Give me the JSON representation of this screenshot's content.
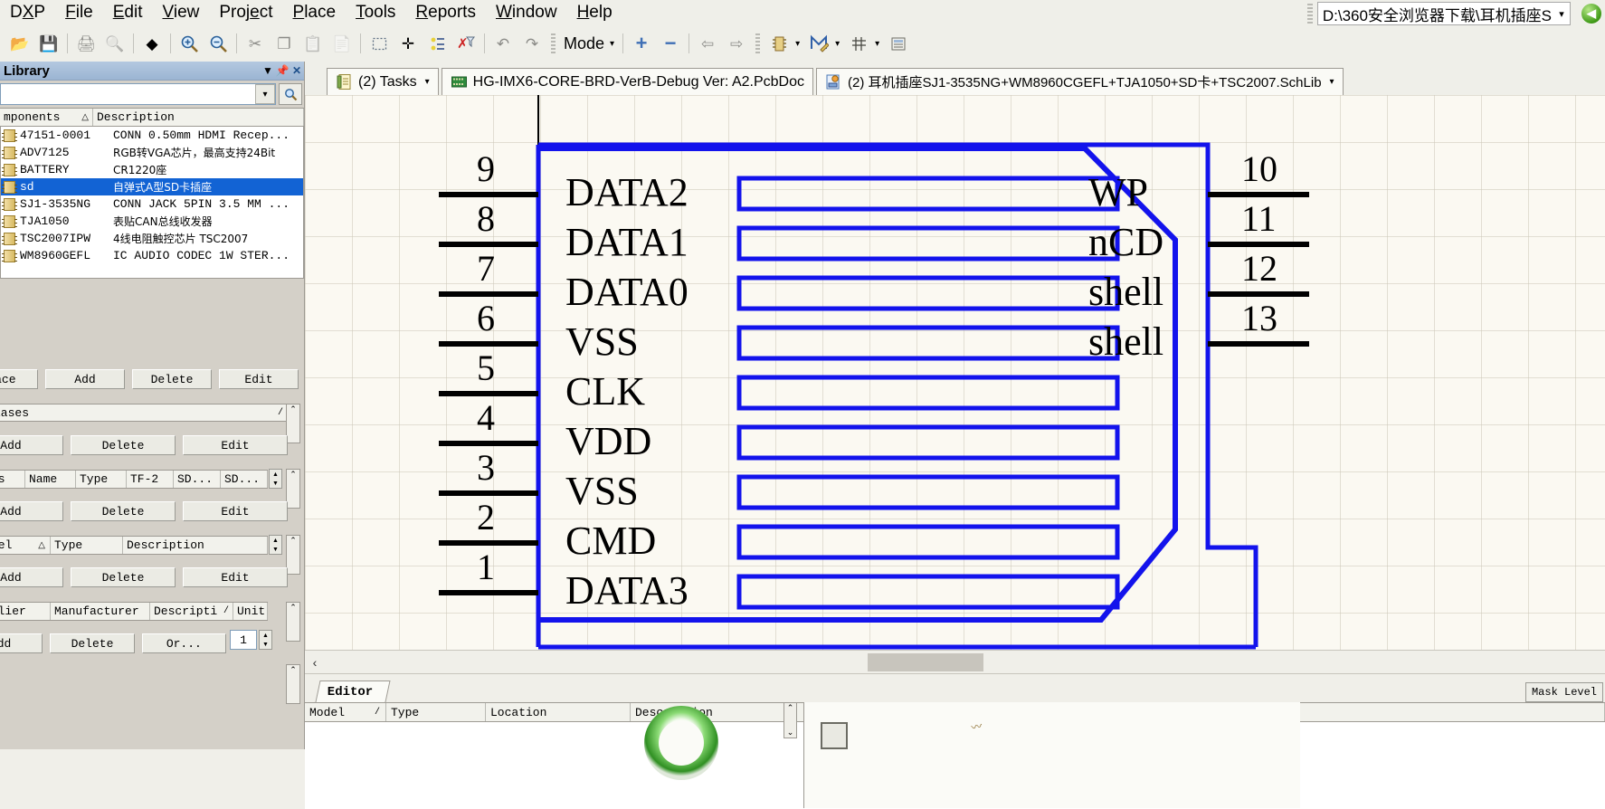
{
  "menu": {
    "items": [
      {
        "pre": "D",
        "accel": "X",
        "post": "P"
      },
      {
        "pre": "",
        "accel": "F",
        "post": "ile"
      },
      {
        "pre": "",
        "accel": "E",
        "post": "dit"
      },
      {
        "pre": "",
        "accel": "V",
        "post": "iew"
      },
      {
        "pre": "Proj",
        "accel": "e",
        "post": "ct"
      },
      {
        "pre": "",
        "accel": "P",
        "post": "lace"
      },
      {
        "pre": "",
        "accel": "T",
        "post": "ools"
      },
      {
        "pre": "",
        "accel": "R",
        "post": "eports"
      },
      {
        "pre": "",
        "accel": "W",
        "post": "indow"
      },
      {
        "pre": "",
        "accel": "H",
        "post": "elp"
      }
    ]
  },
  "path_field": {
    "value": "D:\\360安全浏览器下载\\耳机插座S",
    "caret": "▾"
  },
  "toolbar": {
    "mode_label": "Mode",
    "caret": "▾",
    "icons": [
      "open-folder-icon",
      "save-icon",
      "print-icon",
      "print-preview-icon",
      "board-view-icon",
      "zoom-in-icon",
      "zoom-out-icon",
      "cut-icon",
      "copy-icon",
      "paste-icon",
      "paste-special-icon",
      "select-area-icon",
      "move-icon",
      "smart-paste-icon",
      "clear-filter-icon",
      "undo-icon",
      "redo-icon",
      "add-icon",
      "remove-icon",
      "back-icon",
      "forward-icon",
      "component-icon",
      "draw-icon",
      "grid-icon",
      "browse-icon"
    ]
  },
  "library_panel": {
    "title": "Library",
    "title_icons": [
      "pin-icon",
      "close-icon",
      "chevron-down-icon"
    ],
    "search_value": "",
    "search_caret": "▾",
    "find_icon": "search-icon",
    "components_header": {
      "name_col": "mponents",
      "sort_mark": "△",
      "desc_col": "Description"
    },
    "components": [
      {
        "name": "47151-0001",
        "desc": "CONN 0.50mm HDMI Recep...",
        "cjk": false,
        "selected": false
      },
      {
        "name": "ADV7125",
        "desc": "RGB转VGA芯片，最高支持24Bit",
        "cjk": true,
        "selected": false
      },
      {
        "name": "BATTERY",
        "desc": "CR1220座",
        "cjk": true,
        "selected": false
      },
      {
        "name": "sd",
        "desc": "自弹式A型SD卡插座",
        "cjk": true,
        "selected": true
      },
      {
        "name": "SJ1-3535NG",
        "desc": "CONN JACK 5PIN 3.5 MM ...",
        "cjk": false,
        "selected": false
      },
      {
        "name": "TJA1050",
        "desc": "表贴CAN总线收发器",
        "cjk": true,
        "selected": false
      },
      {
        "name": "TSC2007IPW",
        "desc": "4线电阻触控芯片 TSC2007",
        "cjk": true,
        "selected": false
      },
      {
        "name": "WM8960GEFL",
        "desc": "IC AUDIO CODEC 1W STER...",
        "cjk": false,
        "selected": false
      }
    ],
    "place_row": [
      "Place",
      "Add",
      "Delete",
      "Edit"
    ],
    "aliases_header": {
      "label": "iases",
      "sort_mark": "/"
    },
    "aliases_row": [
      "Add",
      "Delete",
      "Edit"
    ],
    "pins_header": [
      "ns",
      "Name",
      "Type",
      "TF-2",
      "SD...",
      "SD..."
    ],
    "pins_row": [
      "Add",
      "Delete",
      "Edit"
    ],
    "models_header": {
      "name": "del",
      "sort_mark": "△",
      "type": "Type",
      "desc": "Description"
    },
    "models_row": [
      "Add",
      "Delete",
      "Edit"
    ],
    "supplier_header": [
      "pplier",
      "Manufacturer",
      "Descripti",
      "Unit"
    ],
    "supplier_sort": "/",
    "supplier_row": [
      "Add",
      "Delete",
      "Or...",
      "1"
    ]
  },
  "doc_tabs": [
    {
      "label": "(2) Tasks",
      "icon": "tasks-icon",
      "caret": "▾",
      "cjk": false
    },
    {
      "label": "HG-IMX6-CORE-BRD-VerB-Debug Ver: A2.PcbDoc",
      "icon": "pcbdoc-icon",
      "caret": "",
      "cjk": false
    },
    {
      "label": "(2) 耳机插座SJ1-3535NG+WM8960CGEFL+TJA1050+SD卡+TSC2007.SchLib",
      "icon": "schlib-icon",
      "caret": "▾",
      "cjk": true
    }
  ],
  "tab_close_icon": "close-icon",
  "schematic": {
    "symbol_color": "#1313ec",
    "wire_color": "#000000",
    "left_pins": [
      {
        "number": "9",
        "name": "DATA2"
      },
      {
        "number": "8",
        "name": "DATA1"
      },
      {
        "number": "7",
        "name": "DATA0"
      },
      {
        "number": "6",
        "name": "VSS"
      },
      {
        "number": "5",
        "name": "CLK"
      },
      {
        "number": "4",
        "name": "VDD"
      },
      {
        "number": "3",
        "name": "VSS"
      },
      {
        "number": "2",
        "name": "CMD"
      },
      {
        "number": "1",
        "name": "DATA3"
      }
    ],
    "right_pins": [
      {
        "number": "10",
        "name": "WP"
      },
      {
        "number": "11",
        "name": "nCD"
      },
      {
        "number": "12",
        "name": "shell"
      },
      {
        "number": "13",
        "name": "shell"
      }
    ]
  },
  "hscroll": {
    "left_arrow": "‹"
  },
  "bottom": {
    "editor_tab": "Editor",
    "mask_level": "Mask Level",
    "grid_headers": [
      "Model",
      "/",
      "Type",
      "Location",
      "Description"
    ]
  }
}
